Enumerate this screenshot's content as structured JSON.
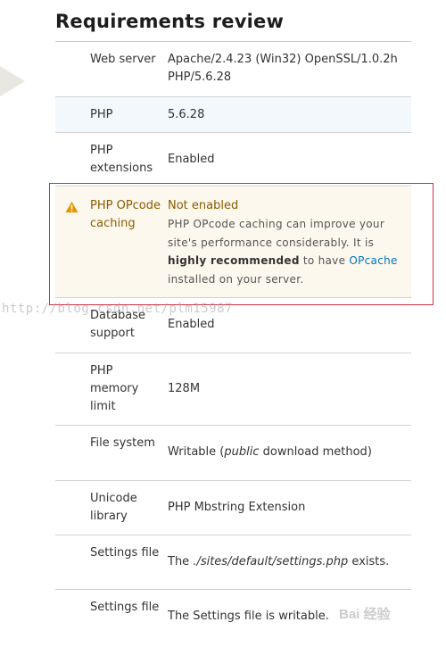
{
  "page": {
    "title": "Requirements review"
  },
  "rows": [
    {
      "label": "Web server",
      "value": "Apache/2.4.23 (Win32) OpenSSL/1.0.2h PHP/5.6.28"
    },
    {
      "label": "PHP",
      "value": "5.6.28",
      "status": "info"
    },
    {
      "label": "PHP extensions",
      "value": "Enabled"
    },
    {
      "label": "PHP OPcode caching",
      "value": "Not enabled",
      "status": "warning",
      "icon": "warning-icon",
      "description": {
        "part1": "PHP OPcode caching can improve your site's performance considerably. It is ",
        "bold": "highly recommended",
        "part2": " to have ",
        "link": "OPcache",
        "part3": " installed on your server."
      }
    },
    {
      "label": "Database support",
      "value": "Enabled"
    },
    {
      "label": "PHP memory limit",
      "value": "128M"
    },
    {
      "label": "File system",
      "value_prefix": "Writable (",
      "value_em": "public",
      "value_suffix": " download method)"
    },
    {
      "label": "Unicode library",
      "value": "PHP Mbstring Extension"
    },
    {
      "label": "Settings file",
      "value_prefix": "The ",
      "value_em": "./sites/default/settings.php",
      "value_suffix": " exists."
    },
    {
      "label": "Settings file",
      "value": "The Settings file is writable."
    }
  ],
  "watermark": {
    "url": "http://blog.csdn.net/plm15987",
    "brand": "Bai 经验"
  },
  "colors": {
    "warning_bg": "#fdf8ed",
    "info_bg": "#f2f8fc",
    "highlight_border": "#cc3344",
    "link": "#0074bd",
    "warning_icon": "#e29700"
  }
}
